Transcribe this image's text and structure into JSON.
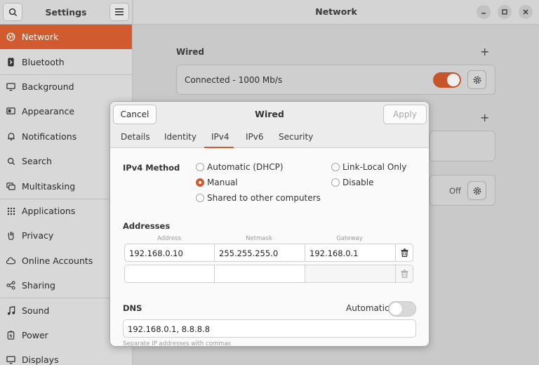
{
  "sidebar": {
    "title": "Settings",
    "items": [
      {
        "label": "Network",
        "icon": "globe-icon"
      },
      {
        "label": "Bluetooth",
        "icon": "bluetooth-icon"
      },
      {
        "label": "Background",
        "icon": "monitor-icon"
      },
      {
        "label": "Appearance",
        "icon": "appearance-icon"
      },
      {
        "label": "Notifications",
        "icon": "bell-icon"
      },
      {
        "label": "Search",
        "icon": "search-icon"
      },
      {
        "label": "Multitasking",
        "icon": "multitasking-icon"
      },
      {
        "label": "Applications",
        "icon": "grid-icon"
      },
      {
        "label": "Privacy",
        "icon": "hand-icon"
      },
      {
        "label": "Online Accounts",
        "icon": "cloud-icon"
      },
      {
        "label": "Sharing",
        "icon": "share-icon"
      },
      {
        "label": "Sound",
        "icon": "music-note-icon"
      },
      {
        "label": "Power",
        "icon": "power-icon"
      },
      {
        "label": "Displays",
        "icon": "display-icon"
      }
    ]
  },
  "main": {
    "title": "Network",
    "wired_section": "Wired",
    "wired_status": "Connected - 1000 Mb/s",
    "wired_toggle_on": true,
    "vpn_status": "Off"
  },
  "dialog": {
    "title": "Wired",
    "cancel_label": "Cancel",
    "apply_label": "Apply",
    "tabs": [
      "Details",
      "Identity",
      "IPv4",
      "IPv6",
      "Security"
    ],
    "active_tab": "IPv4",
    "ipv4_method_label": "IPv4 Method",
    "methods": {
      "automatic": "Automatic (DHCP)",
      "manual": "Manual",
      "shared": "Shared to other computers",
      "link_local": "Link-Local Only",
      "disable": "Disable"
    },
    "selected_method": "Manual",
    "addresses_label": "Addresses",
    "address_columns": [
      "Address",
      "Netmask",
      "Gateway"
    ],
    "address_rows": [
      [
        "192.168.0.10",
        "255.255.255.0",
        "192.168.0.1"
      ],
      [
        "",
        "",
        ""
      ]
    ],
    "dns_label": "DNS",
    "dns_automatic_label": "Automatic",
    "dns_automatic_on": false,
    "dns_value": "192.168.0.1, 8.8.8.8",
    "dns_hint": "Separate IP addresses with commas"
  },
  "colors": {
    "accent": "#d15b2e"
  }
}
